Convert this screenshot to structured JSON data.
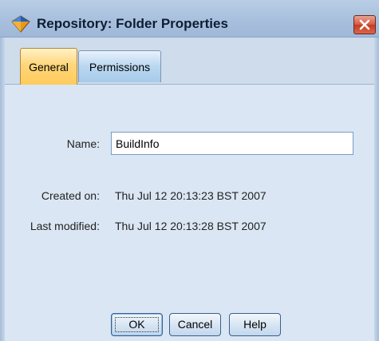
{
  "window": {
    "title": "Repository: Folder Properties",
    "close_icon": "close-icon",
    "app_icon": "repository-diamond-icon"
  },
  "tabs": [
    {
      "label": "General",
      "selected": true
    },
    {
      "label": "Permissions",
      "selected": false
    }
  ],
  "form": {
    "name_label": "Name:",
    "name_value": "BuildInfo",
    "created_label": "Created on:",
    "created_value": "Thu Jul 12 20:13:23 BST 2007",
    "modified_label": "Last modified:",
    "modified_value": "Thu Jul 12 20:13:28 BST 2007"
  },
  "buttons": {
    "ok": "OK",
    "cancel": "Cancel",
    "help": "Help"
  },
  "colors": {
    "selected_tab": "#ffcb5c",
    "close_button": "#d65d43",
    "panel_background": "#dae6f3"
  }
}
